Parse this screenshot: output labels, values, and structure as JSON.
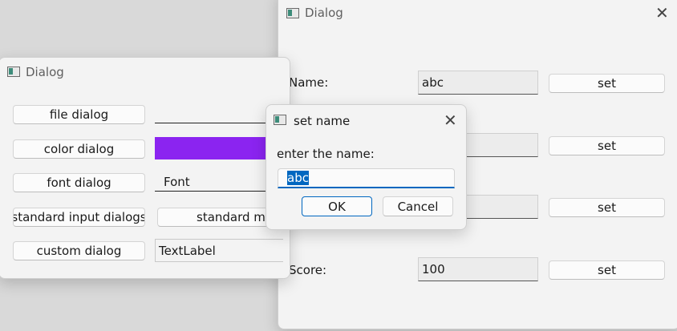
{
  "left_dialog": {
    "title": "Dialog",
    "buttons": {
      "file": "file dialog",
      "color": "color dialog",
      "font": "font dialog",
      "input": "standard input dialogs",
      "message": "standard me",
      "custom": "custom dialog"
    },
    "color_value": "#8b24f0",
    "font_label": "Font",
    "text_label": "TextLabel"
  },
  "right_dialog": {
    "title": "Dialog",
    "name_label": "Name:",
    "name_value": "abc",
    "score_label": "Score:",
    "score_value": "100",
    "set_label": "set"
  },
  "set_name_dialog": {
    "title": "set name",
    "prompt": "enter the name:",
    "input_value": "abc",
    "ok_label": "OK",
    "cancel_label": "Cancel",
    "accent_color": "#0067c0"
  }
}
